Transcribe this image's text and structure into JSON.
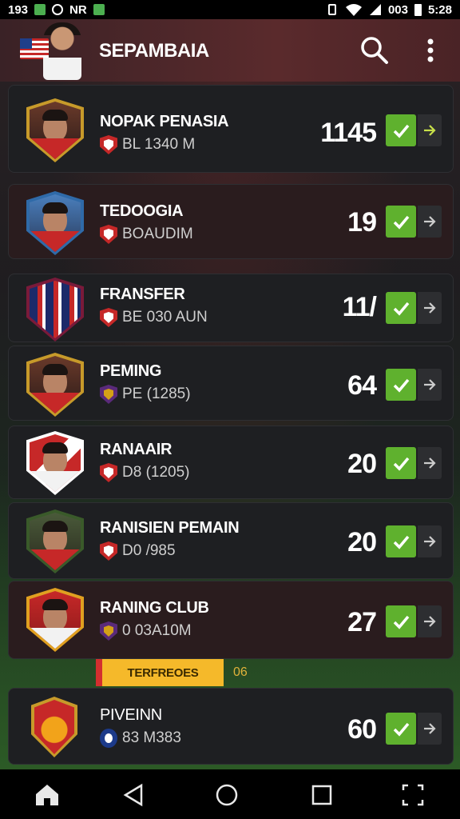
{
  "status_bar": {
    "left_text": "193",
    "carrier": "NR",
    "network": "003",
    "time": "5:28"
  },
  "header": {
    "title": "SEPAMBAIA",
    "icons": [
      "flag-icon",
      "search-icon",
      "more-vert-icon"
    ]
  },
  "players": [
    {
      "name": "NOPAK PENASIA",
      "club": "BL 1340 M",
      "score": "1145"
    },
    {
      "name": "TEDOOGIA",
      "club": "BOAUDIM",
      "score": "19"
    },
    {
      "name": "FRANSFER",
      "club": "BE 030 AUN",
      "score": "11/"
    },
    {
      "name": "PEMING",
      "club": "PE (1285)",
      "score": "64"
    },
    {
      "name": "RANAAIR",
      "club": "D8 (1205)",
      "score": "20"
    },
    {
      "name": "RANISIEN PEMAIN",
      "club": "D0 /985",
      "score": "20"
    },
    {
      "name": "RANING CLUB",
      "club": "0 03A10M",
      "score": "27"
    },
    {
      "name": "PIVEINN",
      "club": "83 M383",
      "score": "60"
    }
  ],
  "section": {
    "label": "TERFREOES",
    "count": "06"
  },
  "colors": {
    "accent_green": "#5fb12e",
    "section_yellow": "#f5b92a",
    "header_red": "#5a2a2c"
  }
}
